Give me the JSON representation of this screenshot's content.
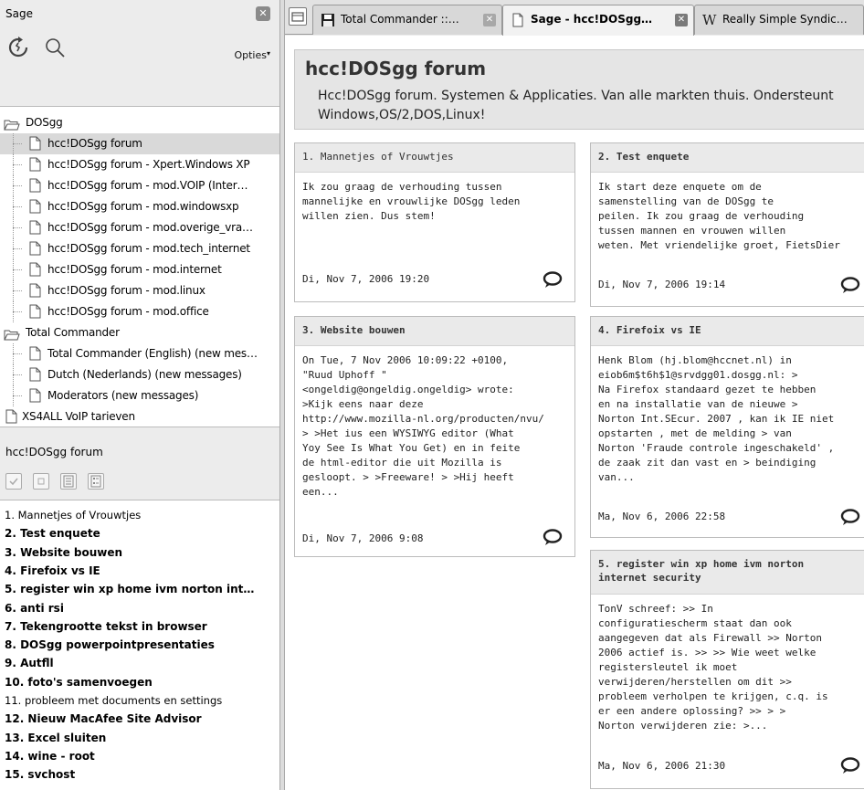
{
  "sidebar": {
    "title": "Sage",
    "options_label": "Opties",
    "feeds": [
      {
        "label": "DOSgg",
        "type": "folder",
        "level": 0
      },
      {
        "label": "hcc!DOSgg forum",
        "type": "feed",
        "level": 1,
        "selected": true
      },
      {
        "label": "hcc!DOSgg forum - Xpert.Windows XP",
        "type": "feed",
        "level": 1
      },
      {
        "label": "hcc!DOSgg forum - mod.VOIP (Inter…",
        "type": "feed",
        "level": 1
      },
      {
        "label": "hcc!DOSgg forum - mod.windowsxp",
        "type": "feed",
        "level": 1
      },
      {
        "label": "hcc!DOSgg forum - mod.overige_vra…",
        "type": "feed",
        "level": 1
      },
      {
        "label": "hcc!DOSgg forum - mod.tech_internet",
        "type": "feed",
        "level": 1
      },
      {
        "label": "hcc!DOSgg forum - mod.internet",
        "type": "feed",
        "level": 1
      },
      {
        "label": "hcc!DOSgg forum - mod.linux",
        "type": "feed",
        "level": 1
      },
      {
        "label": "hcc!DOSgg forum - mod.office",
        "type": "feed",
        "level": 1
      },
      {
        "label": "Total Commander",
        "type": "folder",
        "level": 0
      },
      {
        "label": "Total Commander (English) (new mes…",
        "type": "feed",
        "level": 1
      },
      {
        "label": "Dutch (Nederlands) (new messages)",
        "type": "feed",
        "level": 1
      },
      {
        "label": "Moderators (new messages)",
        "type": "feed",
        "level": 1
      },
      {
        "label": "XS4ALL VoIP tarieven",
        "type": "feed",
        "level": 0
      }
    ],
    "items_header": "hcc!DOSgg forum",
    "items": [
      {
        "label": "1. Mannetjes of Vrouwtjes",
        "read": true
      },
      {
        "label": "2. Test enquete",
        "read": false
      },
      {
        "label": "3. Website bouwen",
        "read": false
      },
      {
        "label": "4. Firefoix vs IE",
        "read": false
      },
      {
        "label": "5. register win xp home ivm norton int…",
        "read": false
      },
      {
        "label": "6. anti rsi",
        "read": false
      },
      {
        "label": "7. Tekengrootte tekst in browser",
        "read": false
      },
      {
        "label": "8. DOSgg powerpointpresentaties",
        "read": false
      },
      {
        "label": "9. Autfll",
        "read": false
      },
      {
        "label": "10. foto's samenvoegen",
        "read": false
      },
      {
        "label": "11. probleem met documents en settings",
        "read": true
      },
      {
        "label": "12. Nieuw MacAfee Site Advisor",
        "read": false
      },
      {
        "label": "13. Excel sluiten",
        "read": false
      },
      {
        "label": "14. wine - root",
        "read": false
      },
      {
        "label": "15. svchost",
        "read": false
      }
    ]
  },
  "tabs": [
    {
      "label": "Total Commander ::…",
      "icon": "floppy-icon",
      "active": false
    },
    {
      "label": "Sage - hcc!DOSgg…",
      "icon": "page-icon",
      "active": true
    },
    {
      "label": "Really Simple Syndic…",
      "icon": "wikipedia-icon",
      "active": false
    }
  ],
  "feed": {
    "title": "hcc!DOSgg forum",
    "description": "Hcc!DOSgg forum. Systemen & Applicaties. Van alle markten thuis. Ondersteunt Windows,OS/2,DOS,Linux!"
  },
  "cards": [
    {
      "title": "1. Mannetjes of Vrouwtjes",
      "read": true,
      "body": [
        "Ik zou graag de verhouding tussen",
        "mannelijke en vrouwlijke DOSgg leden",
        "willen zien. Dus stem!"
      ],
      "date": "Di, Nov 7, 2006 19:20"
    },
    {
      "title": "2. Test enquete",
      "read": false,
      "body": [
        "Ik start deze enquete om de",
        "samenstelling van de DOSgg te",
        "peilen. Ik zou graag de verhouding",
        "tussen mannen en vrouwen willen",
        "weten. Met vriendelijke groet, FietsDier"
      ],
      "date": "Di, Nov 7, 2006 19:14"
    },
    {
      "title": "3. Website bouwen",
      "read": false,
      "body": [
        "On Tue, 7 Nov 2006 10:09:22 +0100,",
        "\"Ruud Uphoff \"",
        "<ongeldig@ongeldig.ongeldig> wrote:",
        ">Kijk eens naar deze",
        "http://www.mozilla-nl.org/producten/nvu/",
        "> >Het ius een WYSIWYG editor (What",
        "Yoy See Is What You Get) en in feite",
        "de html-editor die uit Mozilla is",
        "gesloopt. > >Freeware! > >Hij heeft",
        "een..."
      ],
      "date": "Di, Nov 7, 2006 9:08"
    },
    {
      "title": "4. Firefoix vs IE",
      "read": false,
      "body": [
        "Henk Blom (hj.blom@hccnet.nl) in",
        "eiob6m$t6h$1@srvdgg01.dosgg.nl: >",
        "Na Firefox standaard gezet te hebben",
        "en na installatie van de nieuwe >",
        "Norton Int.SEcur. 2007 , kan ik IE niet",
        "opstarten , met de melding > van",
        "Norton 'Fraude controle ingeschakeld' ,",
        "de zaak zit dan vast en > beindiging",
        "van..."
      ],
      "date": "Ma, Nov 6, 2006 22:58"
    },
    {
      "title": "5. register win xp home ivm norton internet security",
      "title_lines": [
        "5. register win xp home ivm norton",
        "internet security"
      ],
      "read": false,
      "body": [
        "TonV schreef: >> In",
        "configuratiescherm staat dan ook",
        "aangegeven dat als Firewall >> Norton",
        "2006 actief is. >> >> Wie weet welke",
        "registersleutel ik moet",
        "verwijderen/herstellen om dit >>",
        "probleem verholpen te krijgen, c.q. is",
        "er een andere oplossing? >> > >",
        "Norton verwijderen zie: >..."
      ],
      "date": "Ma, Nov 6, 2006 21:30"
    }
  ]
}
